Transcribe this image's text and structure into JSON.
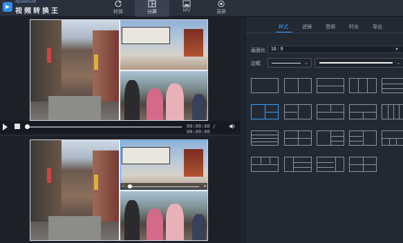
{
  "app": {
    "brand_en": "Apowersoft",
    "brand_cn": "视频转换王"
  },
  "tabs": [
    {
      "label": "转换",
      "icon": "refresh-icon"
    },
    {
      "label": "分屏",
      "icon": "split-screen-icon",
      "active": true
    },
    {
      "label": "MV",
      "icon": "image-icon"
    },
    {
      "label": "录屏",
      "icon": "record-icon"
    }
  ],
  "player": {
    "timecode": "00:00:00 / 00:00:00",
    "progress": 0
  },
  "right_panel": {
    "subtabs": [
      "样式",
      "滤镜",
      "音频",
      "时长",
      "导出"
    ],
    "active_subtab": 0,
    "ratio_label": "画面比",
    "ratio_value": "16 : 9",
    "border_label": "边框"
  },
  "colors": {
    "accent": "#3aa0ff",
    "bg": "#1e2430"
  }
}
